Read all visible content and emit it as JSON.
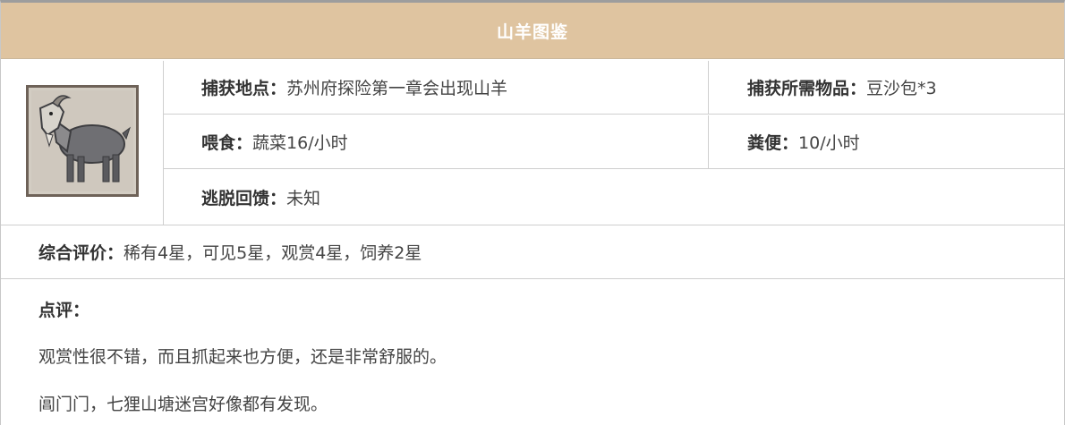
{
  "header": {
    "title": "山羊图鉴"
  },
  "avatar": {
    "icon": "goat-icon"
  },
  "info": {
    "capture_location": {
      "label": "捕获地点：",
      "value": "苏州府探险第一章会出现山羊"
    },
    "capture_items": {
      "label": "捕获所需物品：",
      "value": "豆沙包*3"
    },
    "feeding": {
      "label": "喂食：",
      "value": "蔬菜16/小时"
    },
    "manure": {
      "label": "粪便：",
      "value": "10/小时"
    },
    "escape": {
      "label": "逃脱回馈：",
      "value": "未知"
    }
  },
  "rating": {
    "label": "综合评价：",
    "value": "稀有4星，可见5星，观赏4星，饲养2星"
  },
  "comment": {
    "label": "点评：",
    "paragraphs": [
      "观赏性很不错，而且抓起来也方便，还是非常舒服的。",
      "阊门门，七狸山塘迷宫好像都有发现。"
    ]
  }
}
